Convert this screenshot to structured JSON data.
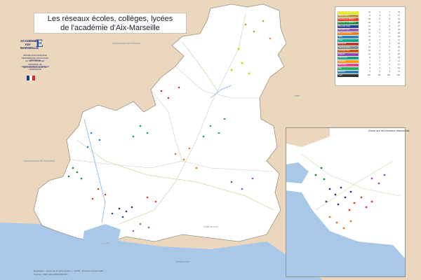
{
  "title": {
    "line1": "Les réseaux écoles, collèges, lycées",
    "line2": "de l'académie d'Aix-Marseille"
  },
  "logo": {
    "academie": "ACADÉMIE",
    "city": "AIX-MARSEILLE",
    "letter": "E",
    "ministry1": "RÉPUBLIQUE FRANÇAISE",
    "ministry2": "MINISTÈRE DE L'ÉDUCATION NATIONALE",
    "ministry3": "ET DE LA JEUNESSE",
    "ministry4": "MINISTÈRE DE L'ENSEIGNEMENT SUPÉRIEUR",
    "ministry5": "DE LA RECHERCHE ET DE L'INNOVATION",
    "flag_colors": [
      "#1f3b8c",
      "#ffffff",
      "#d9262e"
    ]
  },
  "legend": {
    "rows": [
      {
        "name": "Alpes-de-Hte-Provence",
        "color": "#e8e30f",
        "v": [
          "12",
          "4",
          "7",
          "23"
        ]
      },
      {
        "name": "Hautes-Alpes",
        "color": "#c49a2c",
        "v": [
          "9",
          "3",
          "5",
          "17"
        ]
      },
      {
        "name": "Bouches-du-Rhône 1",
        "color": "#e33b2e",
        "v": [
          "18",
          "6",
          "8",
          "32"
        ]
      },
      {
        "name": "Bouches-du-Rhône 2",
        "color": "#1d8f3a",
        "v": [
          "16",
          "5",
          "7",
          "28"
        ]
      },
      {
        "name": "Marseille Nord",
        "color": "#27408b",
        "v": [
          "21",
          "7",
          "9",
          "37"
        ]
      },
      {
        "name": "Marseille Sud",
        "color": "#9b59b6",
        "v": [
          "19",
          "6",
          "8",
          "33"
        ]
      },
      {
        "name": "Aix-en-Provence",
        "color": "#e67e22",
        "v": [
          "15",
          "5",
          "6",
          "26"
        ]
      },
      {
        "name": "Arles",
        "color": "#2e86c1",
        "v": [
          "11",
          "4",
          "5",
          "20"
        ]
      },
      {
        "name": "Istres",
        "color": "#17a589",
        "v": [
          "10",
          "3",
          "4",
          "17"
        ]
      },
      {
        "name": "Martigues",
        "color": "#c0392b",
        "v": [
          "9",
          "3",
          "4",
          "16"
        ]
      },
      {
        "name": "Vaucluse Nord",
        "color": "#7f8c8d",
        "v": [
          "13",
          "4",
          "6",
          "23"
        ]
      },
      {
        "name": "Vaucluse Sud",
        "color": "#d35400",
        "v": [
          "12",
          "4",
          "5",
          "21"
        ]
      },
      {
        "name": "Avignon",
        "color": "#8e44ad",
        "v": [
          "14",
          "5",
          "6",
          "25"
        ]
      },
      {
        "name": "Carpentras",
        "color": "#16a085",
        "v": [
          "8",
          "3",
          "4",
          "15"
        ]
      },
      {
        "name": "Cavaillon",
        "color": "#f39c12",
        "v": [
          "7",
          "2",
          "3",
          "12"
        ]
      },
      {
        "name": "Manosque",
        "color": "#e84393",
        "v": [
          "8",
          "3",
          "3",
          "14"
        ]
      },
      {
        "name": "Gap",
        "color": "#27ae60",
        "v": [
          "9",
          "3",
          "4",
          "16"
        ]
      },
      {
        "name": "Briançon",
        "color": "#2980b9",
        "v": [
          "6",
          "2",
          "3",
          "11"
        ]
      },
      {
        "name": "Total",
        "color": "#333333",
        "v": [
          "247",
          "82",
          "103",
          "432"
        ]
      }
    ]
  },
  "inset": {
    "title": "Zoom sur les réseaux marseillais"
  },
  "sea_labels": {
    "north_west": "Gouvernement de l'Occitanie",
    "south": "Méditerranée",
    "south_center": "Golfe du Lion",
    "east": "Italie",
    "north": "Département de la Drôme"
  },
  "footer": {
    "line1": "Réalisation : service de la carte scolaire — SIASE · Données rentrée 2019",
    "line2": "Sources : DEP, base ADRESSE IGN"
  },
  "colors": {
    "land": "#ffffff",
    "outside": "#ead7bd",
    "sea": "#a9c8e8",
    "border": "#9a9488",
    "road": "#c8d9a8",
    "river": "#bcd6f0"
  }
}
